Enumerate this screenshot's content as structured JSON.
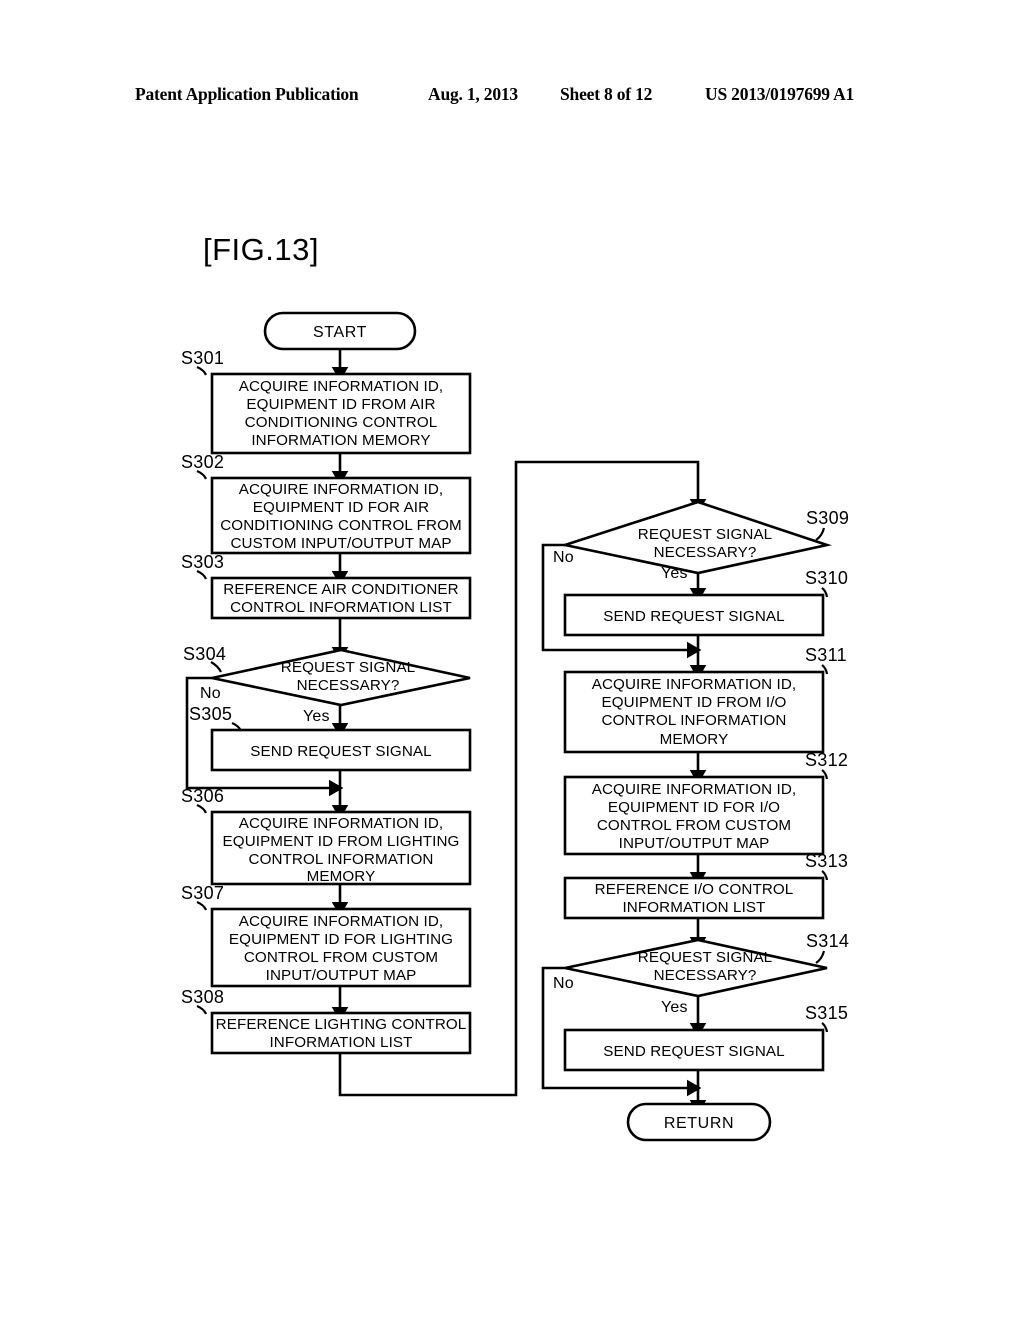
{
  "header": {
    "publication": "Patent Application Publication",
    "date": "Aug. 1, 2013",
    "sheet": "Sheet 8 of 12",
    "patent_number": "US 2013/0197699 A1"
  },
  "figure": {
    "label": "[FIG.13]"
  },
  "flowchart": {
    "terminators": {
      "start": "START",
      "return": "RETURN"
    },
    "branch_labels": {
      "yes": "Yes",
      "no": "No"
    },
    "nodes": [
      {
        "id": "S301",
        "step": "S301",
        "type": "process",
        "lines": [
          "ACQUIRE INFORMATION ID,",
          "EQUIPMENT ID FROM AIR",
          "CONDITIONING CONTROL",
          "INFORMATION MEMORY"
        ]
      },
      {
        "id": "S302",
        "step": "S302",
        "type": "process",
        "lines": [
          "ACQUIRE INFORMATION ID,",
          "EQUIPMENT ID FOR AIR",
          "CONDITIONING CONTROL FROM",
          "CUSTOM INPUT/OUTPUT MAP"
        ]
      },
      {
        "id": "S303",
        "step": "S303",
        "type": "process",
        "lines": [
          "REFERENCE AIR CONDITIONER",
          "CONTROL INFORMATION LIST"
        ]
      },
      {
        "id": "S304",
        "step": "S304",
        "type": "decision",
        "lines": [
          "REQUEST SIGNAL",
          "NECESSARY?"
        ]
      },
      {
        "id": "S305",
        "step": "S305",
        "type": "process",
        "lines": [
          "SEND REQUEST SIGNAL"
        ]
      },
      {
        "id": "S306",
        "step": "S306",
        "type": "process",
        "lines": [
          "ACQUIRE INFORMATION ID,",
          "EQUIPMENT ID FROM LIGHTING",
          "CONTROL INFORMATION",
          "MEMORY"
        ]
      },
      {
        "id": "S307",
        "step": "S307",
        "type": "process",
        "lines": [
          "ACQUIRE INFORMATION ID,",
          "EQUIPMENT ID FOR LIGHTING",
          "CONTROL FROM CUSTOM",
          "INPUT/OUTPUT MAP"
        ]
      },
      {
        "id": "S308",
        "step": "S308",
        "type": "process",
        "lines": [
          "REFERENCE LIGHTING CONTROL",
          "INFORMATION LIST"
        ]
      },
      {
        "id": "S309",
        "step": "S309",
        "type": "decision",
        "lines": [
          "REQUEST SIGNAL",
          "NECESSARY?"
        ]
      },
      {
        "id": "S310",
        "step": "S310",
        "type": "process",
        "lines": [
          "SEND REQUEST SIGNAL"
        ]
      },
      {
        "id": "S311",
        "step": "S311",
        "type": "process",
        "lines": [
          "ACQUIRE INFORMATION ID,",
          "EQUIPMENT ID FROM I/O",
          "CONTROL INFORMATION",
          "MEMORY"
        ]
      },
      {
        "id": "S312",
        "step": "S312",
        "type": "process",
        "lines": [
          "ACQUIRE INFORMATION ID,",
          "EQUIPMENT ID FOR I/O",
          "CONTROL FROM CUSTOM",
          "INPUT/OUTPUT MAP"
        ]
      },
      {
        "id": "S313",
        "step": "S313",
        "type": "process",
        "lines": [
          "REFERENCE I/O CONTROL",
          "INFORMATION LIST"
        ]
      },
      {
        "id": "S314",
        "step": "S314",
        "type": "decision",
        "lines": [
          "REQUEST SIGNAL",
          "NECESSARY?"
        ]
      },
      {
        "id": "S315",
        "step": "S315",
        "type": "process",
        "lines": [
          "SEND REQUEST SIGNAL"
        ]
      }
    ]
  }
}
